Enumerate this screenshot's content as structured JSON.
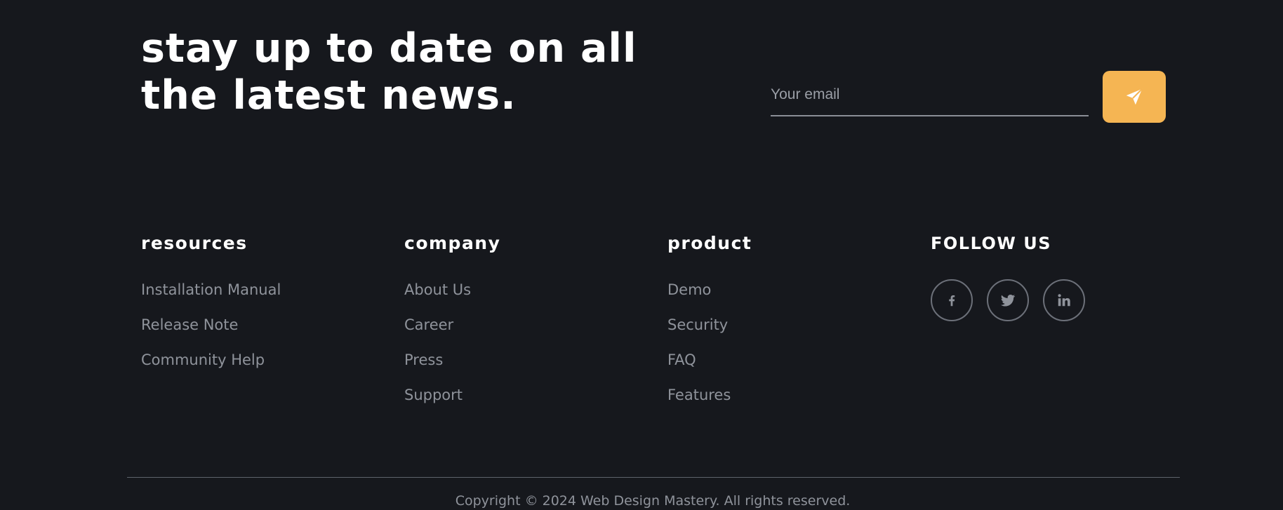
{
  "newsletter": {
    "headline": "Stay up to date on all the latest news.",
    "email_placeholder": "Your email",
    "email_value": "",
    "send_icon": "paper-plane-icon"
  },
  "columns": [
    {
      "title": "Resources",
      "links": [
        "Installation Manual",
        "Release Note",
        "Community Help"
      ]
    },
    {
      "title": "Company",
      "links": [
        "About Us",
        "Career",
        "Press",
        "Support"
      ]
    },
    {
      "title": "Product",
      "links": [
        "Demo",
        "Security",
        "FAQ",
        "Features"
      ]
    }
  ],
  "follow": {
    "title": "Follow Us",
    "icons": [
      "facebook-icon",
      "twitter-icon",
      "linkedin-icon"
    ]
  },
  "footer": {
    "copyright": "Copyright © 2024 Web Design Mastery. All rights reserved."
  },
  "colors": {
    "background": "#16181d",
    "accent": "#f5b553",
    "link": "#8f939b",
    "heading": "#ffffff"
  }
}
